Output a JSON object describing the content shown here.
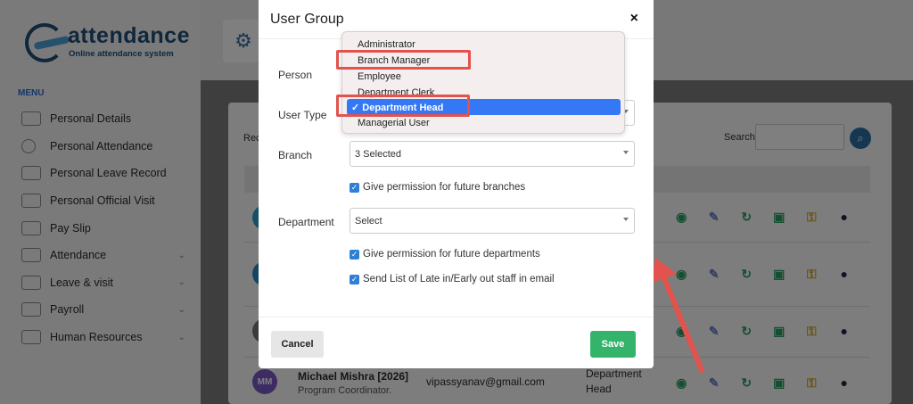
{
  "logo": {
    "brand": "attendance",
    "tagline": "Online attendance system"
  },
  "sidebar": {
    "menu_label": "MENU",
    "items": [
      {
        "label": "Personal Details",
        "icon": "id-card-icon",
        "expandable": false
      },
      {
        "label": "Personal Attendance",
        "icon": "clock-icon",
        "expandable": false
      },
      {
        "label": "Personal Leave Record",
        "icon": "plane-icon",
        "expandable": false
      },
      {
        "label": "Personal Official Visit",
        "icon": "briefcase-icon",
        "expandable": false
      },
      {
        "label": "Pay Slip",
        "icon": "money-icon",
        "expandable": false
      },
      {
        "label": "Attendance",
        "icon": "timer-icon",
        "expandable": true
      },
      {
        "label": "Leave & visit",
        "icon": "calendar-icon",
        "expandable": true
      },
      {
        "label": "Payroll",
        "icon": "wallet-icon",
        "expandable": true
      },
      {
        "label": "Human Resources",
        "icon": "people-icon",
        "expandable": true
      }
    ]
  },
  "main": {
    "records_label": "Rec",
    "search_label": "Search",
    "last_row": {
      "initials": "MM",
      "name": "Michael Mishra [2026]",
      "title": "Program Coordinator.",
      "email": "vipassyanav@gmail.com",
      "department_line1": "Department",
      "department_line2": "Head"
    }
  },
  "modal": {
    "title": "User Group",
    "close_symbol": "×",
    "fields": {
      "person_label": "Person",
      "user_type_label": "User Type",
      "branch_label": "Branch",
      "branch_value": "3 Selected",
      "department_label": "Department",
      "department_value": "Select"
    },
    "checkboxes": {
      "future_branches": "Give permission for future branches",
      "future_departments": "Give permission for future departments",
      "send_late_list": "Send List of Late in/Early out staff in email"
    },
    "buttons": {
      "cancel": "Cancel",
      "save": "Save"
    }
  },
  "user_type_dropdown": {
    "options": [
      "Administrator",
      "Branch Manager",
      "Employee",
      "Department Clerk",
      "Department Head",
      "Managerial User"
    ],
    "selected": "Department Head",
    "selected_display": "✓ Department Head",
    "highlighted": [
      "Branch Manager",
      "Department Head"
    ]
  },
  "colors": {
    "brand_blue": "#1e4d77",
    "primary": "#3478f6",
    "save_green": "#34b46b",
    "annotation_red": "#e3524d"
  }
}
